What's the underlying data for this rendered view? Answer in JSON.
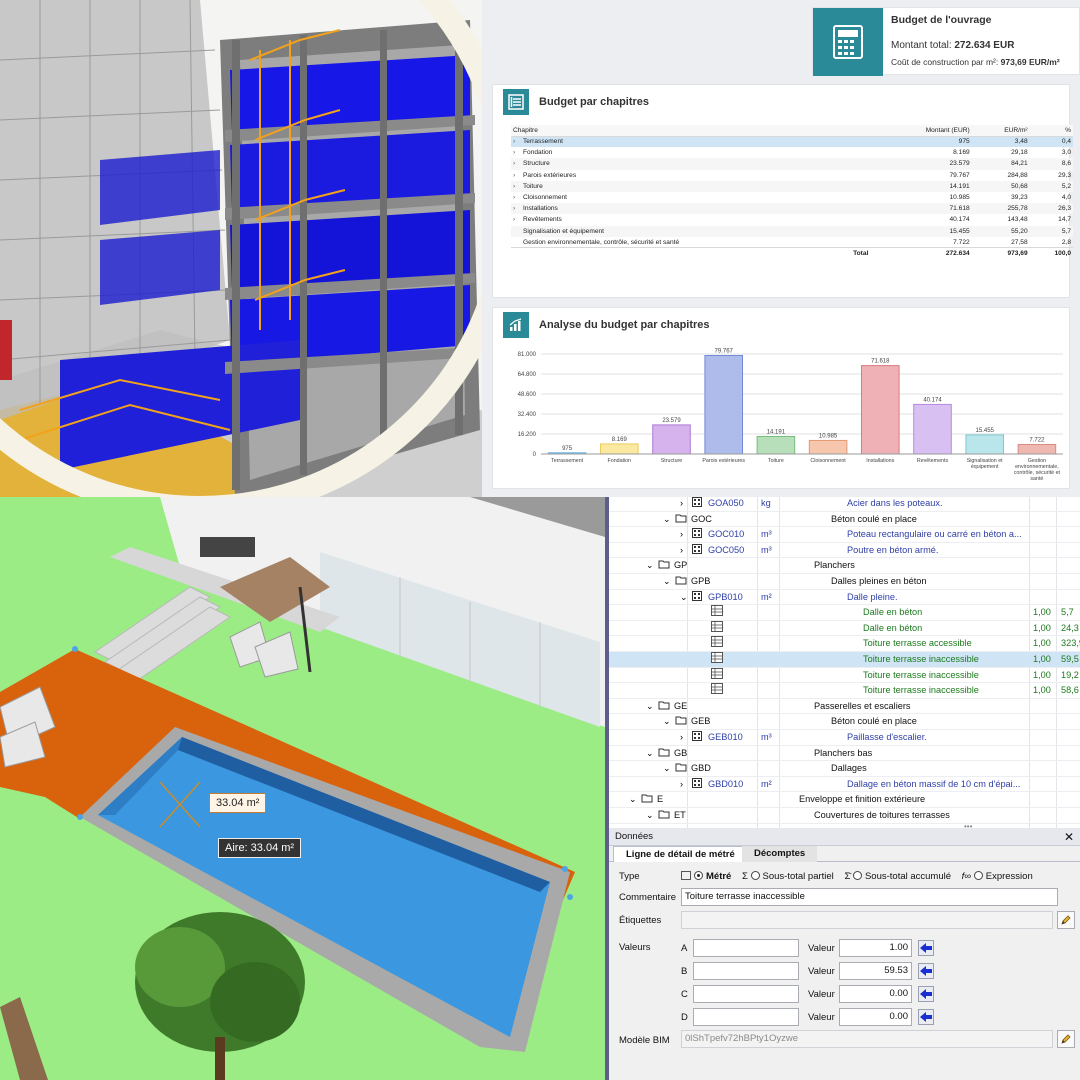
{
  "budget_ouvrage": {
    "title": "Budget de l'ouvrage",
    "montant_label": "Montant total: ",
    "montant_value": "272.634 EUR",
    "cout_label": "Coût de construction par m²: ",
    "cout_value": "973,69 EUR/m²"
  },
  "chapitres": {
    "title": "Budget par chapitres",
    "headers": [
      "Chapitre",
      "Montant (EUR)",
      "EUR/m²",
      "%"
    ],
    "rows": [
      {
        "name": "Terrassement",
        "montant": "975",
        "eurm2": "3,48",
        "pct": "0,4",
        "expand": true
      },
      {
        "name": "Fondation",
        "montant": "8.169",
        "eurm2": "29,18",
        "pct": "3,0",
        "expand": true
      },
      {
        "name": "Structure",
        "montant": "23.579",
        "eurm2": "84,21",
        "pct": "8,6",
        "expand": true
      },
      {
        "name": "Parois extérieures",
        "montant": "79.767",
        "eurm2": "284,88",
        "pct": "29,3",
        "expand": true
      },
      {
        "name": "Toiture",
        "montant": "14.191",
        "eurm2": "50,68",
        "pct": "5,2",
        "expand": true
      },
      {
        "name": "Cloisonnement",
        "montant": "10.985",
        "eurm2": "39,23",
        "pct": "4,0",
        "expand": true
      },
      {
        "name": "Installations",
        "montant": "71.618",
        "eurm2": "255,78",
        "pct": "26,3",
        "expand": true
      },
      {
        "name": "Revêtements",
        "montant": "40.174",
        "eurm2": "143,48",
        "pct": "14,7",
        "expand": true
      },
      {
        "name": "Signalisation et équipement",
        "montant": "15.455",
        "eurm2": "55,20",
        "pct": "5,7",
        "expand": false
      },
      {
        "name": "Gestion environnementale, contrôle, sécurité et santé",
        "montant": "7.722",
        "eurm2": "27,58",
        "pct": "2,8",
        "expand": false
      }
    ],
    "total": {
      "label": "Total",
      "montant": "272.634",
      "eurm2": "973,69",
      "pct": "100,0"
    }
  },
  "analyse": {
    "title": "Analyse du budget par chapitres"
  },
  "chart_data": {
    "type": "bar",
    "categories": [
      "Terrassement",
      "Fondation",
      "Structure",
      "Parois extérieures",
      "Toiture",
      "Cloisonnement",
      "Installations",
      "Revêtements",
      "Signalisation et équipement",
      "Gestion environnementale, contrôle, sécurité et santé"
    ],
    "values": [
      975,
      8169,
      23579,
      79767,
      14191,
      10985,
      71618,
      40174,
      15455,
      7722
    ],
    "value_labels": [
      "975",
      "8.169",
      "23.579",
      "79.767",
      "14.191",
      "10.985",
      "71.618",
      "40.174",
      "15.455",
      "7.722"
    ],
    "yticks": [
      "0",
      "16.200",
      "32.400",
      "48.600",
      "64.800",
      "81.000"
    ],
    "ylim": [
      0,
      81000
    ],
    "colors": [
      "#9fd3f0",
      "#fbe9a2",
      "#d6b3ec",
      "#aebcec",
      "#b6dfba",
      "#f6c6ad",
      "#efb1b5",
      "#d9c0f2",
      "#b9e6ea",
      "#eeb8b0"
    ],
    "borders": [
      "#62b2e0",
      "#e8cc5c",
      "#b07ad8",
      "#7288d8",
      "#78be80",
      "#e39a74",
      "#d97b82",
      "#b58ae0",
      "#7fcad2",
      "#d88c82"
    ],
    "grid": true,
    "title": "",
    "xlabel": "",
    "ylabel": ""
  },
  "pool": {
    "area_label": "33.04 m²",
    "aire_label": "Aire: 33.04 m²"
  },
  "tree": {
    "rows": [
      {
        "level": 4,
        "chev": ">",
        "icon": "grid",
        "code": "GOA050",
        "unit": "kg",
        "desc": "Acier dans les poteaux.",
        "desc_color": "blue",
        "qty": "",
        "price": ""
      },
      {
        "level": 3,
        "chev": "v",
        "icon": "folder",
        "code": "GOC",
        "unit": "",
        "desc": "Béton coulé en place",
        "desc_color": "black",
        "qty": "",
        "price": ""
      },
      {
        "level": 4,
        "chev": ">",
        "icon": "grid",
        "code": "GOC010",
        "unit": "m³",
        "desc": "Poteau rectangulaire ou carré en béton a...",
        "desc_color": "blue",
        "qty": "",
        "price": ""
      },
      {
        "level": 4,
        "chev": ">",
        "icon": "grid",
        "code": "GOC050",
        "unit": "m³",
        "desc": "Poutre en béton armé.",
        "desc_color": "blue",
        "qty": "",
        "price": ""
      },
      {
        "level": 2,
        "chev": "v",
        "icon": "folder",
        "code": "GP",
        "unit": "",
        "desc": "Planchers",
        "desc_color": "black",
        "qty": "",
        "price": ""
      },
      {
        "level": 3,
        "chev": "v",
        "icon": "folder",
        "code": "GPB",
        "unit": "",
        "desc": "Dalles pleines en béton",
        "desc_color": "black",
        "qty": "",
        "price": ""
      },
      {
        "level": 4,
        "chev": "v",
        "icon": "grid",
        "code": "GPB010",
        "unit": "m²",
        "desc": "Dalle pleine.",
        "desc_color": "blue",
        "qty": "",
        "price": ""
      },
      {
        "level": 5,
        "chev": "",
        "icon": "meas",
        "code": "",
        "unit": "",
        "desc": "Dalle en béton",
        "desc_color": "green",
        "qty": "1,00",
        "price": "5,7"
      },
      {
        "level": 5,
        "chev": "",
        "icon": "meas",
        "code": "",
        "unit": "",
        "desc": "Dalle en béton",
        "desc_color": "green",
        "qty": "1,00",
        "price": "24,3"
      },
      {
        "level": 5,
        "chev": "",
        "icon": "meas",
        "code": "",
        "unit": "",
        "desc": "Toiture terrasse accessible",
        "desc_color": "green",
        "qty": "1,00",
        "price": "323,9"
      },
      {
        "level": 5,
        "chev": "",
        "icon": "meas",
        "code": "",
        "unit": "",
        "desc": "Toiture terrasse inaccessible",
        "desc_color": "green",
        "qty": "1,00",
        "price": "59,5",
        "selected": true
      },
      {
        "level": 5,
        "chev": "",
        "icon": "meas",
        "code": "",
        "unit": "",
        "desc": "Toiture terrasse inaccessible",
        "desc_color": "green",
        "qty": "1,00",
        "price": "19,2"
      },
      {
        "level": 5,
        "chev": "",
        "icon": "meas",
        "code": "",
        "unit": "",
        "desc": "Toiture terrasse inaccessible",
        "desc_color": "green",
        "qty": "1,00",
        "price": "58,6"
      },
      {
        "level": 2,
        "chev": "v",
        "icon": "folder",
        "code": "GE",
        "unit": "",
        "desc": "Passerelles et escaliers",
        "desc_color": "black",
        "qty": "",
        "price": ""
      },
      {
        "level": 3,
        "chev": "v",
        "icon": "folder",
        "code": "GEB",
        "unit": "",
        "desc": "Béton coulé en place",
        "desc_color": "black",
        "qty": "",
        "price": ""
      },
      {
        "level": 4,
        "chev": ">",
        "icon": "grid",
        "code": "GEB010",
        "unit": "m³",
        "desc": "Paillasse d'escalier.",
        "desc_color": "blue",
        "qty": "",
        "price": ""
      },
      {
        "level": 2,
        "chev": "v",
        "icon": "folder",
        "code": "GB",
        "unit": "",
        "desc": "Planchers bas",
        "desc_color": "black",
        "qty": "",
        "price": ""
      },
      {
        "level": 3,
        "chev": "v",
        "icon": "folder",
        "code": "GBD",
        "unit": "",
        "desc": "Dallages",
        "desc_color": "black",
        "qty": "",
        "price": ""
      },
      {
        "level": 4,
        "chev": ">",
        "icon": "grid",
        "code": "GBD010",
        "unit": "m²",
        "desc": "Dallage en béton massif de 10 cm d'épai...",
        "desc_color": "blue",
        "qty": "",
        "price": ""
      },
      {
        "level": 1,
        "chev": "v",
        "icon": "folder",
        "code": "E",
        "unit": "",
        "desc": "Enveloppe et finition extérieure",
        "desc_color": "black",
        "qty": "",
        "price": ""
      },
      {
        "level": 2,
        "chev": "v",
        "icon": "folder",
        "code": "ET",
        "unit": "",
        "desc": "Couvertures de toitures terrasses",
        "desc_color": "black",
        "qty": "",
        "price": ""
      }
    ]
  },
  "donnees": {
    "panel_title": "Données",
    "tab_active": "Ligne de détail de métré",
    "tab_inactive": "Décomptes",
    "type_label": "Type",
    "type_options": [
      "Métré",
      "Sous-total partiel",
      "Sous-total accumulé",
      "Expression"
    ],
    "type_selected": "Métré",
    "commentaire_label": "Commentaire",
    "commentaire_value": "Toiture terrasse inaccessible",
    "etiquettes_label": "Étiquettes",
    "valeurs_label": "Valeurs",
    "valeur_label": "Valeur",
    "values": [
      {
        "key": "A",
        "input": "",
        "valeur": "1.00"
      },
      {
        "key": "B",
        "input": "",
        "valeur": "59.53"
      },
      {
        "key": "C",
        "input": "",
        "valeur": "0.00"
      },
      {
        "key": "D",
        "input": "",
        "valeur": "0.00"
      }
    ],
    "bim_label": "Modèle BIM",
    "bim_value": "0lShTpefv72hBPty1Oyzwe"
  }
}
